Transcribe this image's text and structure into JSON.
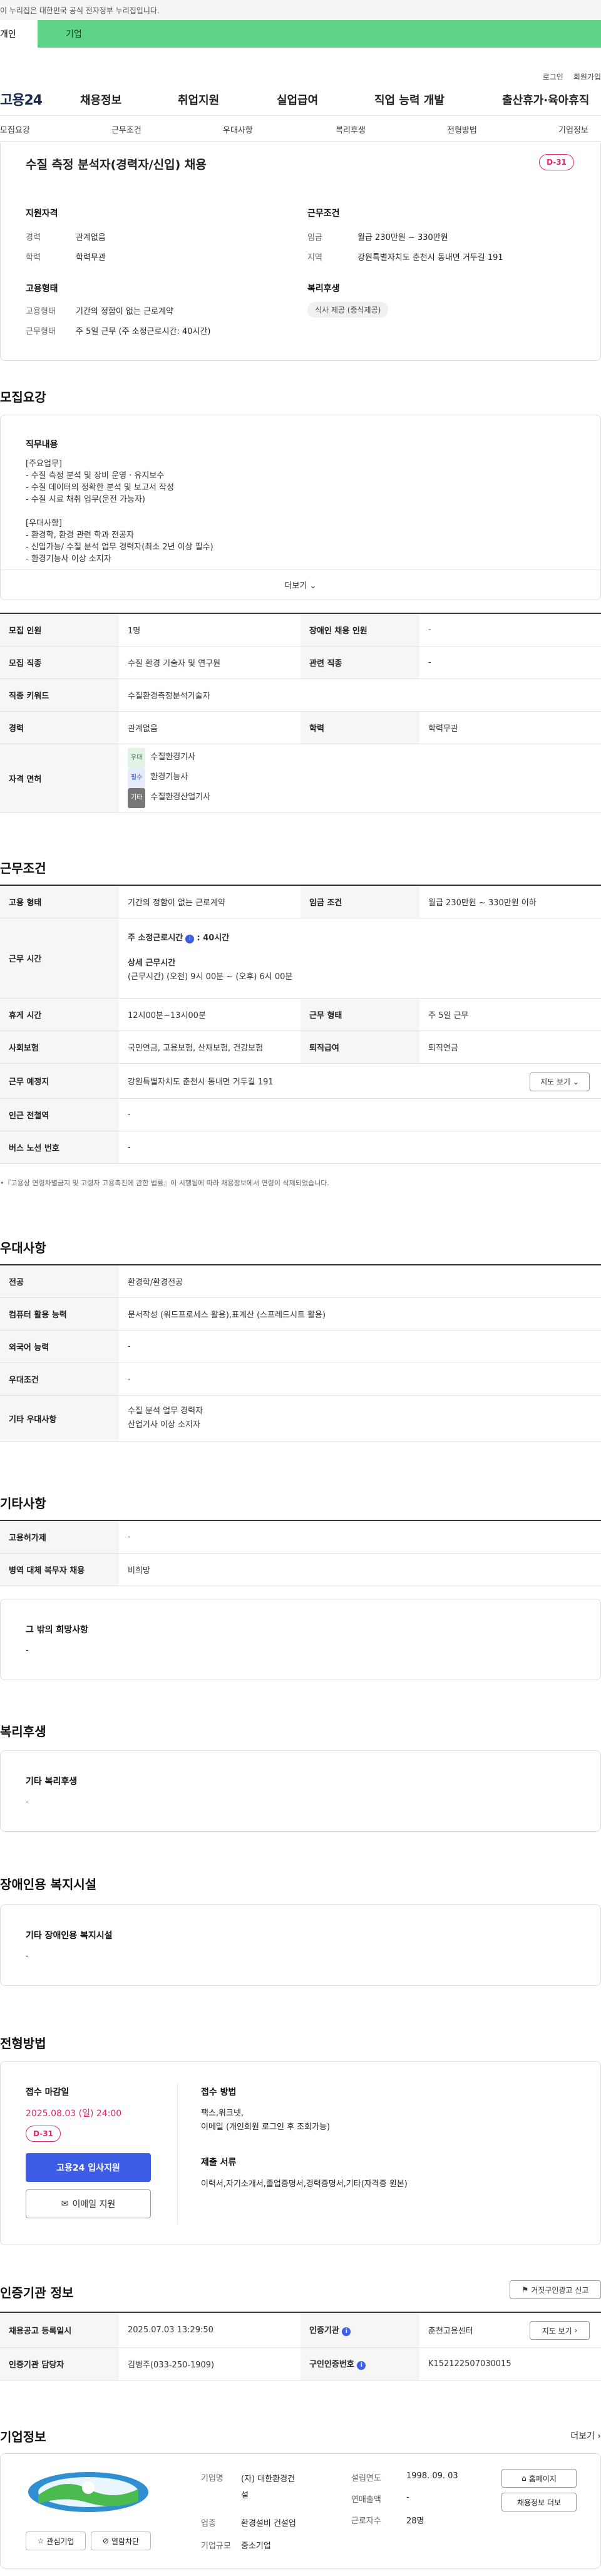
{
  "gov_banner": "이 누리집은 대한민국 공식 전자정부 누리집입니다.",
  "user_tabs": {
    "personal": "개인",
    "company": "기업"
  },
  "util": {
    "login": "로그인",
    "join": "회원가입"
  },
  "logo": "고용24",
  "gnb": [
    "채용정보",
    "취업지원",
    "실업급여",
    "직업 능력 개발",
    "출산휴가·육아휴직"
  ],
  "subnav": [
    "모집요강",
    "근무조건",
    "우대사항",
    "복리후생",
    "전형방법",
    "기업정보"
  ],
  "job": {
    "title": "수질 측정 분석자(경력자/신입) 채용",
    "dday": "D-31",
    "qualify_title": "지원자격",
    "career_label": "경력",
    "career": "관계없음",
    "edu_label": "학력",
    "edu": "학력무관",
    "cond_title": "근무조건",
    "wage_label": "임금",
    "wage": "월급 230만원 ~ 330만원",
    "area_label": "지역",
    "area": "강원특별자치도 춘천시 동내면 거두길 191",
    "emp_title": "고용형태",
    "emp_type_label": "고용형태",
    "emp_type": "기간의 정함이 없는 근로계약",
    "work_type_label": "근무형태",
    "work_type": "주 5일 근무 (주 소정근로시간: 40시간)",
    "welfare_title": "복리후생",
    "welfare_tag": "식사 제공 (중식제공)"
  },
  "recruit": {
    "section": "모집요강",
    "duty_title": "직무내용",
    "duty_lines": [
      "[주요업무]",
      "- 수질 측정 분석 및 장비 운영 · 유지보수",
      "- 수질 데이터의 정확한 분석 및 보고서 작성",
      "- 수질 시료 채취 업무(운전 가능자)",
      "",
      "[우대사항]",
      "- 환경학, 환경 관련 학과 전공자",
      "- 신입가능/ 수질 분석 업무 경력자(최소 2년 이상 필수)",
      "- 환경기능사 이상 소지자"
    ],
    "more": "더보기",
    "count_label": "모집 인원",
    "count": "1명",
    "disabled_label": "장애인 채용 인원",
    "disabled": "-",
    "job_label": "모집 직종",
    "job": "수질 환경 기술자 및 연구원",
    "related_label": "관련 직종",
    "related": "-",
    "kw_label": "직종 키워드",
    "kw": "수질환경측정분석기술자",
    "career_label": "경력",
    "career": "관계없음",
    "edu_label": "학력",
    "edu": "학력무관",
    "lic_label": "자격 면허",
    "licenses": [
      {
        "badge": "우대",
        "name": "수질환경기사"
      },
      {
        "badge": "필수",
        "name": "환경기능사"
      },
      {
        "badge": "기타",
        "name": "수질환경산업기사"
      }
    ]
  },
  "work": {
    "section": "근무조건",
    "emp_label": "고용 형태",
    "emp": "기간의 정함이 없는 근로계약",
    "wage_label": "임금 조건",
    "wage": "월급 230만원 ~ 330만원 이하",
    "time_label": "근무 시간",
    "weekly": "주 소정근로시간",
    "weekly_val": ": 40시간",
    "detail_title": "상세 근무시간",
    "detail": "(근무시간) (오전) 9시 00분 ~ (오후) 6시 00분",
    "break_label": "휴게 시간",
    "break": "12시00분~13시00분",
    "form_label": "근무 형태",
    "form": "주 5일 근무",
    "ins_label": "사회보험",
    "ins": "국민연금, 고용보험, 산재보험, 건강보험",
    "ret_label": "퇴직급여",
    "ret": "퇴직연금",
    "place_label": "근무 예정지",
    "place": "강원특별자치도 춘천시 동내면 거두길 191",
    "map_btn": "지도 보기",
    "subway_label": "인근 전철역",
    "subway": "-",
    "bus_label": "버스 노선 번호",
    "bus": "-",
    "note": "•『고용상 연령차별금지 및 고령자 고용촉진에 관한 법률』이 시행됨에 따라 채용정보에서 연령이 삭제되었습니다."
  },
  "pref": {
    "section": "우대사항",
    "major_label": "전공",
    "major": "환경학/환경전공",
    "pc_label": "컴퓨터 활용 능력",
    "pc": "문서작성 (워드프로세스 활용),표계산 (스프레드시트 활용)",
    "lang_label": "외국어 능력",
    "lang": "-",
    "cond_label": "우대조건",
    "cond": "-",
    "etc_label": "기타 우대사항",
    "etc1": "수질 분석 업무 경력자",
    "etc2": "산업기사 이상 소지자"
  },
  "other": {
    "section": "기타사항",
    "hire_label": "고용허가제",
    "hire": "-",
    "mil_label": "병역 대체 복무자 채용",
    "mil": "비희망",
    "wish_title": "그 밖의 희망사항",
    "wish": "-"
  },
  "benefit": {
    "section": "복리후생",
    "title": "기타 복리후생",
    "val": "-"
  },
  "disabled": {
    "section": "장애인용 복지시설",
    "title": "기타 장애인용 복지시설",
    "val": "-"
  },
  "apply": {
    "section": "전형방법",
    "deadline_title": "접수 마감일",
    "deadline": "2025.08.03 (일) 24:00",
    "dday": "D-31",
    "apply_btn": "고용24 입사지원",
    "email_btn": "이메일 지원",
    "method_title": "접수 방법",
    "method1": "팩스,워크넷,",
    "method2": "이메일 (개인회원 로그인 후 조회가능)",
    "docs_title": "제출 서류",
    "docs": "이력서,자기소개서,졸업증명서,경력증명서,기타(자격증 원본)"
  },
  "agency": {
    "section": "인증기관 정보",
    "report_btn": "거짓구인광고 신고",
    "reg_label": "채용공고 등록일시",
    "reg": "2025.07.03 13:29:50",
    "org_label": "인증기관",
    "org": "춘천고용센터",
    "map_btn": "지도 보기",
    "mgr_label": "인증기관 담당자",
    "mgr": "김병주(033-250-1909)",
    "no_label": "구인인증번호",
    "no": "K152122507030015"
  },
  "company": {
    "section": "기업정보",
    "more": "더보기",
    "name_label": "기업명",
    "name1": "(자) 대한환경건",
    "name2": "설",
    "ind_label": "업종",
    "ind": "환경설비 건설업",
    "size_label": "기업규모",
    "size": "중소기업",
    "est_label": "설립연도",
    "est": "1998. 09. 03",
    "sales_label": "연매출액",
    "sales": "-",
    "emp_label": "근로자수",
    "emp": "28명",
    "home_btn": "홈페이지",
    "more_btn": "채용정보 더보",
    "fav_btn": "관심기업",
    "block_btn": "열람차단"
  }
}
